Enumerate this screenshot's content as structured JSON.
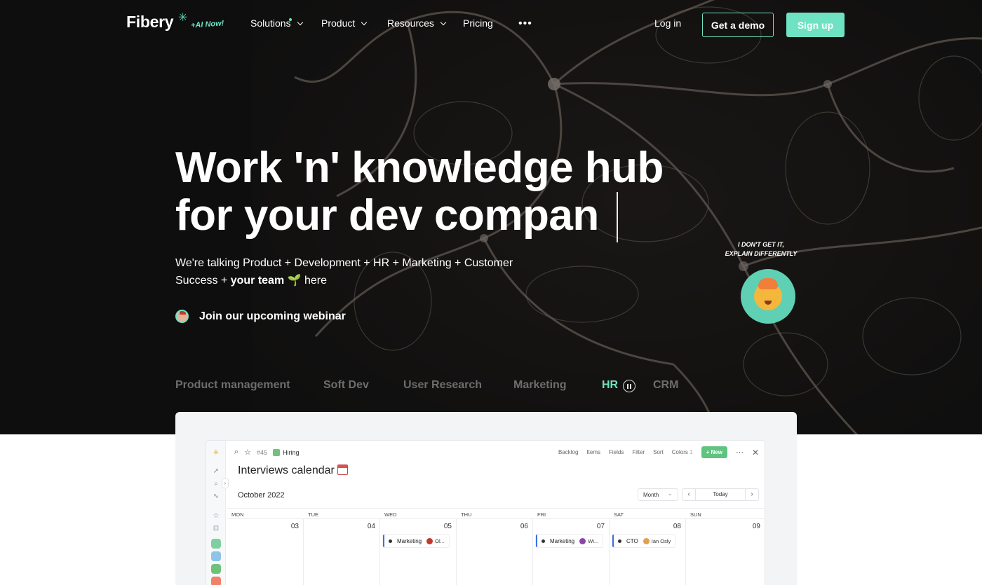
{
  "nav": {
    "logo": "Fibery",
    "badge": "+AI Now!",
    "items": [
      {
        "label": "Solutions"
      },
      {
        "label": "Product"
      },
      {
        "label": "Resources"
      },
      {
        "label": "Pricing"
      }
    ],
    "more": "•••",
    "login": "Log in",
    "demo": "Get a demo",
    "signup": "Sign up"
  },
  "hero": {
    "headline_line1": "Work 'n' knowledge hub",
    "headline_line2": "for your dev compan",
    "sub_part1": "We're talking Product + Development + HR + Marketing + Customer Success + ",
    "sub_bold": "your team",
    "sub_part2": " 🌱 here",
    "webinar": "Join our upcoming webinar",
    "explain_line1": "I don't get it,",
    "explain_line2": "explain differently"
  },
  "tabs": {
    "items": [
      "Product management",
      "Soft Dev",
      "User Research",
      "Marketing",
      "HR",
      "CRM"
    ],
    "active": "HR"
  },
  "app": {
    "issue_count": "#45",
    "breadcrumb": "Hiring",
    "toolbar": [
      "Backlog",
      "Items",
      "Fields",
      "Filter",
      "Sort",
      "Colors"
    ],
    "colors_count": "1",
    "new_label": "+ New",
    "title": "Interviews calendar",
    "month": "October 2022",
    "view": "Month",
    "today": "Today",
    "days": [
      "MON",
      "TUE",
      "WED",
      "THU",
      "FRI",
      "SAT",
      "SUN"
    ],
    "dates": [
      "03",
      "04",
      "05",
      "06",
      "07",
      "08",
      "09"
    ],
    "events": [
      {
        "day": 2,
        "label": "Marketing",
        "person": "Ol...",
        "color": "#c0392b"
      },
      {
        "day": 4,
        "label": "Marketing",
        "person": "Wi...",
        "color": "#8e44ad"
      },
      {
        "day": 5,
        "label": "CTO",
        "person": "Ian Osly",
        "color": "#e0a050"
      }
    ]
  },
  "colors": {
    "accent": "#6ee2c2",
    "background": "#0e0e0e"
  }
}
